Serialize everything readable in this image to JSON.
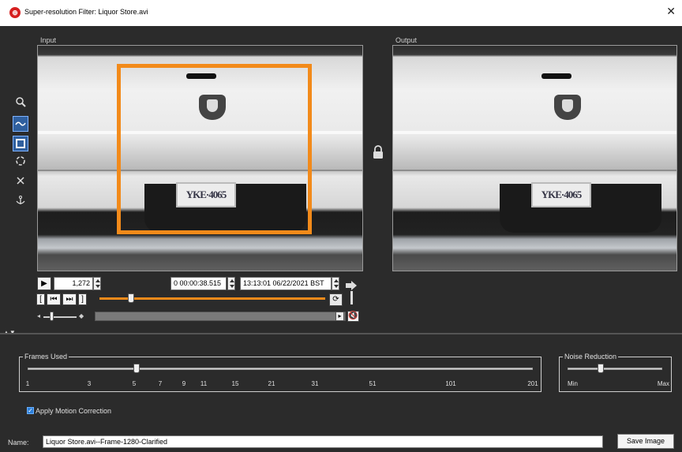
{
  "window": {
    "title": "Super-resolution Filter: Liquor Store.avi",
    "close": "✕"
  },
  "panels": {
    "input_label": "Input",
    "output_label": "Output"
  },
  "scene": {
    "plate_text": "YKE·4065"
  },
  "playback": {
    "play": "▶",
    "frame_number": "1,272",
    "timecode": "0 00:00:38.515",
    "datetime": "13:13:01 06/22/2021 BST",
    "timeline_position": 0.14,
    "volume_level": 0.25
  },
  "frames_used": {
    "title": "Frames Used",
    "ticks": [
      "1",
      "3",
      "5",
      "7",
      "9",
      "11",
      "15",
      "21",
      "31",
      "51",
      "101",
      "201"
    ],
    "selected": "5"
  },
  "noise_reduction": {
    "title": "Noise Reduction",
    "min_label": "Min",
    "max_label": "Max",
    "level": 0.35
  },
  "motion": {
    "label": "Apply Motion Correction",
    "checked": true,
    "check": "✓"
  },
  "footer": {
    "name_label": "Name:",
    "name_value": "Liquor Store.avi--Frame-1280-Clarified",
    "save_label": "Save Image"
  },
  "colors": {
    "accent": "#f28a1a",
    "highlight": "#2f5f9e",
    "background": "#2b2b2b"
  }
}
